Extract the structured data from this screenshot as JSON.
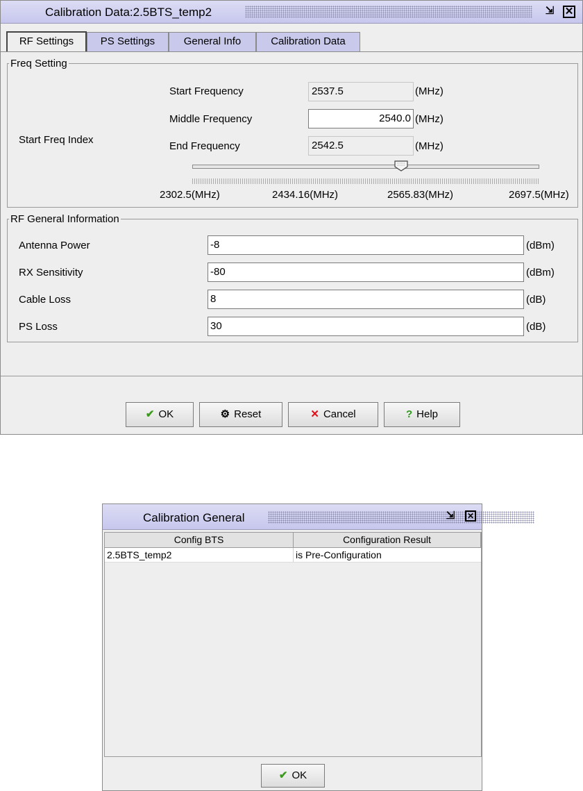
{
  "dialog1": {
    "title": "Calibration Data:2.5BTS_temp2",
    "tabs": [
      "RF Settings",
      "PS Settings",
      "General Info",
      "Calibration Data"
    ],
    "freq_setting": {
      "legend": "Freq Setting",
      "start_index_label": "Start Freq Index",
      "start_label": "Start Frequency",
      "start_value": "2537.5",
      "middle_label": "Middle Frequency",
      "middle_value": "2540.0",
      "end_label": "End Frequency",
      "end_value": "2542.5",
      "unit": "(MHz)",
      "slider_value": 2540.0,
      "slider_min": 2302.5,
      "slider_max": 2697.5,
      "scale_labels": [
        "2302.5(MHz)",
        "2434.16(MHz)",
        "2565.83(MHz)",
        "2697.5(MHz)"
      ]
    },
    "rf_general": {
      "legend": "RF General Information",
      "rows": [
        {
          "label": "Antenna Power",
          "value": "-8",
          "unit": "(dBm)"
        },
        {
          "label": "RX Sensitivity",
          "value": "-80",
          "unit": "(dBm)"
        },
        {
          "label": "Cable Loss",
          "value": "8",
          "unit": "(dB)"
        },
        {
          "label": "PS Loss",
          "value": "30",
          "unit": "(dB)"
        }
      ]
    },
    "buttons": {
      "ok": "OK",
      "reset": "Reset",
      "cancel": "Cancel",
      "help": "Help"
    }
  },
  "dialog2": {
    "title": "Calibration General",
    "columns": [
      "Config BTS",
      "Configuration Result"
    ],
    "rows": [
      {
        "bts": "2.5BTS_temp2",
        "result": "is Pre-Configuration"
      }
    ],
    "ok": "OK"
  },
  "colors": {
    "titlebar": "#c7c7ee",
    "tab": "#c9c9ec",
    "ok_icon": "#3a9a1a",
    "cancel_icon": "#e0101a",
    "help_icon": "#2c9a1a"
  }
}
